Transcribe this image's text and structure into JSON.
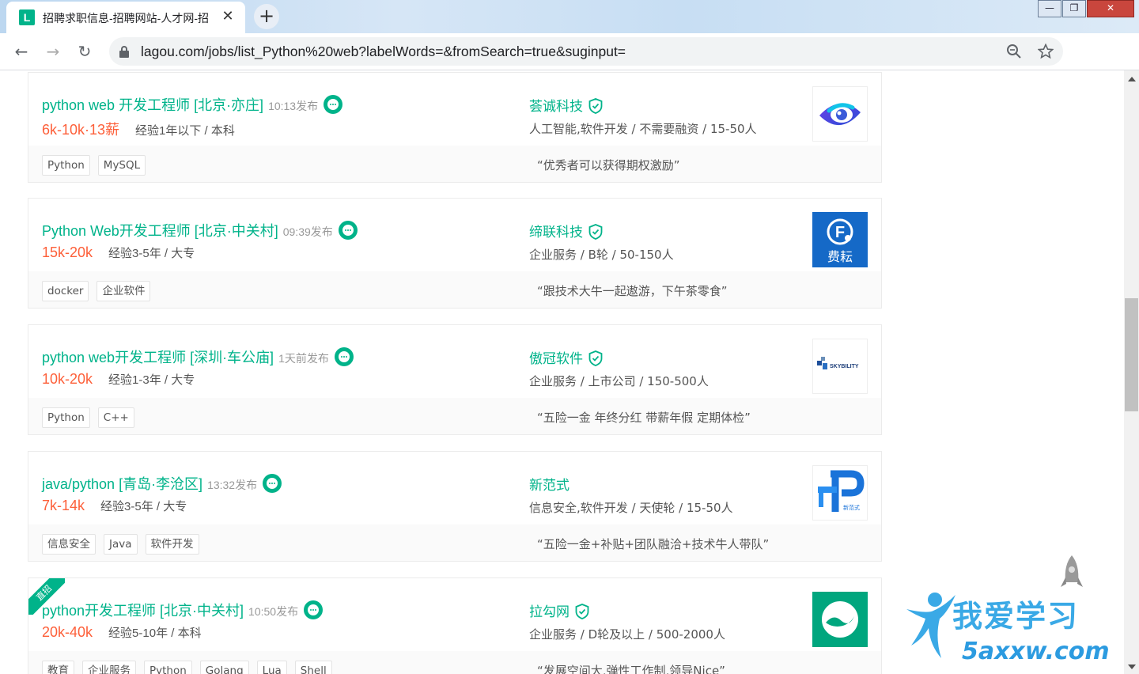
{
  "browser": {
    "tab_title": "招聘求职信息-招聘网站-人才网-招",
    "favicon_letter": "L",
    "tab_close": "✕",
    "new_tab": "+",
    "url": "lagou.com/jobs/list_Python%20web?labelWords=&fromSearch=true&suginput=",
    "win_min": "—",
    "win_max": "❐",
    "win_close": "✕"
  },
  "nav": {
    "back": "←",
    "forward": "→",
    "reload": "↻"
  },
  "jobs": [
    {
      "title": "python web 开发工程师 [北京·亦庄]",
      "time": "10:13发布",
      "salary": "6k-10k·13薪",
      "requirement": "经验1年以下 / 本科",
      "tags": [
        "Python",
        "MySQL"
      ],
      "company": "荟诚科技",
      "verified": true,
      "industry": "人工智能,软件开发 / 不需要融资 / 15-50人",
      "slogan": "“优秀者可以获得期权激励”",
      "logo": "eye-logo"
    },
    {
      "title": "Python Web开发工程师 [北京·中关村]",
      "time": "09:39发布",
      "salary": "15k-20k",
      "requirement": "经验3-5年 / 大专",
      "tags": [
        "docker",
        "企业软件"
      ],
      "company": "缔联科技",
      "verified": true,
      "industry": "企业服务 / B轮 / 50-150人",
      "slogan": "“跟技术大牛一起遨游，下午茶零食”",
      "logo": "feiyun-logo",
      "logo_text": "费耘"
    },
    {
      "title": "python web开发工程师 [深圳·车公庙]",
      "time": "1天前发布",
      "salary": "10k-20k",
      "requirement": "经验1-3年 / 大专",
      "tags": [
        "Python",
        "C++"
      ],
      "company": "傲冠软件",
      "verified": true,
      "industry": "企业服务 / 上市公司 / 150-500人",
      "slogan": "“五险一金 年终分红 带薪年假 定期体检”",
      "logo": "skybility-logo",
      "logo_text": "SKYBILITY"
    },
    {
      "title": "java/python [青岛·李沧区]",
      "time": "13:32发布",
      "salary": "7k-14k",
      "requirement": "经验3-5年 / 大专",
      "tags": [
        "信息安全",
        "Java",
        "软件开发"
      ],
      "company": "新范式",
      "verified": false,
      "industry": "信息安全,软件开发 / 天使轮 / 15-50人",
      "slogan": "“五险一金+补贴+团队融洽+技术牛人带队”",
      "logo": "xinfanshi-logo",
      "logo_text": "新范式"
    },
    {
      "title": "python开发工程师 [北京·中关村]",
      "time": "10:50发布",
      "salary": "20k-40k",
      "requirement": "经验5-10年 / 本科",
      "tags": [
        "教育",
        "企业服务",
        "Python",
        "Golang",
        "Lua",
        "Shell"
      ],
      "company": "拉勾网",
      "verified": true,
      "industry": "企业服务 / D轮及以上 / 500-2000人",
      "slogan": "“发展空间大,弹性工作制,领导Nice”",
      "logo": "lagou-logo",
      "ribbon": "直招"
    }
  ],
  "watermark": {
    "text": "我爱学习",
    "url": "5axxw.com"
  },
  "colors": {
    "brand": "#00b38a",
    "salary": "#fd5f39"
  }
}
